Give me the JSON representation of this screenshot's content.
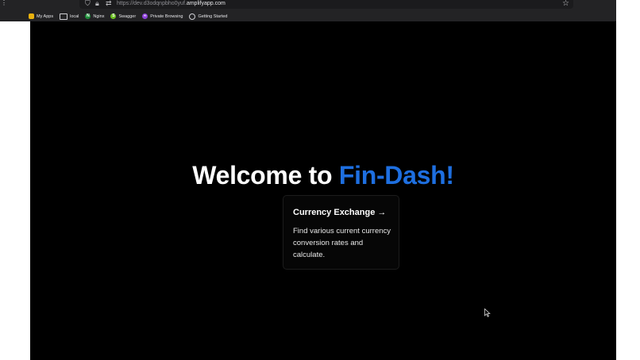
{
  "browser": {
    "url_prefix": "https://dev.d3odqnpbho0yuf.",
    "url_domain": "amplifyapp.com",
    "bookmarks": [
      {
        "label": "My Apps",
        "icon": "apps-icon"
      },
      {
        "label": "local",
        "icon": "folder-icon"
      },
      {
        "label": "Nginx",
        "icon": "nginx-icon"
      },
      {
        "label": "Swagger",
        "icon": "swagger-icon"
      },
      {
        "label": "Private Browsing",
        "icon": "private-browsing-icon"
      },
      {
        "label": "Getting Started",
        "icon": "globe-icon"
      }
    ]
  },
  "page": {
    "welcome_prefix": "Welcome to ",
    "brand_name": "Fin-Dash!",
    "brand_color": "#1e6fe0",
    "card": {
      "title": "Currency Exchange →",
      "description": "Find various current currency conversion rates and calculate."
    }
  }
}
